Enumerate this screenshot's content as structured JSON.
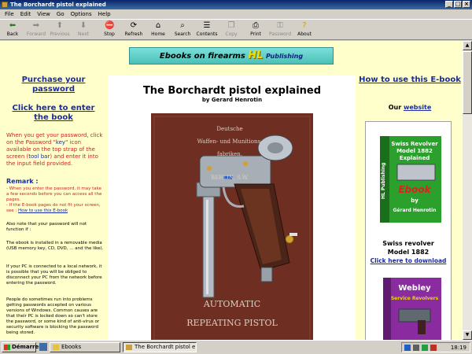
{
  "window": {
    "title": "The Borchardt pistol explained"
  },
  "menu": [
    "File",
    "Edit",
    "View",
    "Go",
    "Options",
    "Help"
  ],
  "toolbar": [
    {
      "label": "Back",
      "icon": "back-arrow-icon",
      "enabled": true
    },
    {
      "label": "Forward",
      "icon": "forward-arrow-icon",
      "enabled": false
    },
    {
      "label": "Previous",
      "icon": "up-arrow-icon",
      "enabled": false
    },
    {
      "label": "Next",
      "icon": "down-arrow-icon",
      "enabled": false
    },
    {
      "label": "Stop",
      "icon": "stop-icon",
      "enabled": true
    },
    {
      "label": "Refresh",
      "icon": "refresh-icon",
      "enabled": true
    },
    {
      "label": "Home",
      "icon": "home-icon",
      "enabled": true
    },
    {
      "label": "Search",
      "icon": "search-icon",
      "enabled": true
    },
    {
      "label": "Contents",
      "icon": "contents-icon",
      "enabled": true
    },
    {
      "label": "Copy",
      "icon": "copy-icon",
      "enabled": false
    },
    {
      "label": "Print",
      "icon": "print-icon",
      "enabled": true
    },
    {
      "label": "Password",
      "icon": "key-icon",
      "enabled": false
    },
    {
      "label": "About",
      "icon": "about-icon",
      "enabled": true
    }
  ],
  "banner": {
    "left": "Ebooks on firearms",
    "logo": "HL",
    "right": "Publishing"
  },
  "left": {
    "purchase": "Purchase your password",
    "enter": "Click here to enter the book",
    "instr_1": "When you get your password, click on the Password \"",
    "instr_key": "key",
    "instr_2": "\" icon available on the top strap of the screen (",
    "instr_toolbar": "tool bar",
    "instr_3": ") and enter it into the input field provided.",
    "remark_title": "Remark :",
    "remark_1": "- When you enter the password, it may take a few seconds before you can access all the pages.",
    "remark_2": "- If the E-book pages do not fit your screen, see : ",
    "remark_link": "How to use this E-book",
    "note_1": "Also note that your password will not function if :",
    "note_2": "The ebook is installed in a removable media (USB memory key, CD, DVD, ... and the like).",
    "note_3": "If your PC is connected to a local network, it is possible that you will be obliged to disconnect your PC from the network before entering the password.",
    "note_4": "People do sometimes run into problems getting passwords accepted on various versions of Windows. Common causes are that their PC is locked down so can't store the password, or some kind of anti-virus or security software is blocking the password being stored."
  },
  "center": {
    "title": "The Borchardt pistol explained",
    "author": "by Gerard Henrotin",
    "cover_maker_1": "Deutsche",
    "cover_maker_2": "Waffen- und Munitions-",
    "cover_maker_3": "fabriken.",
    "cover_city": "BERLIN, S.W.",
    "cover_bottom_1": "AUTOMATIC",
    "cover_bottom_2": "REPEATING PISTOL"
  },
  "right": {
    "howto": "How to use this E-book",
    "our": "Our ",
    "website": "website",
    "book1_t1": "Swiss Revolver",
    "book1_t2": "Model 1882",
    "book1_t3": "Explained",
    "book1_ebook": "Ebook",
    "book1_by": "by",
    "book1_author": "Gérard Henrotin",
    "book1_side": "HL Publishing",
    "book1_cap_1": "Swiss revolver",
    "book1_cap_2": "Model 1882",
    "book1_link": "Click here to download",
    "book2_t1": "Webley",
    "book2_t2": "Service Revolvers"
  },
  "taskbar": {
    "start": "Démarrer",
    "tasks": [
      {
        "label": "Ebooks",
        "active": false
      },
      {
        "label": "The Borchardt pistol e...",
        "active": true
      }
    ],
    "clock": "18:19"
  },
  "colors": {
    "page_bg": "#ffffcc",
    "link": "#1a2ca0",
    "red": "#d02020",
    "title_bar": "#0a246a"
  }
}
